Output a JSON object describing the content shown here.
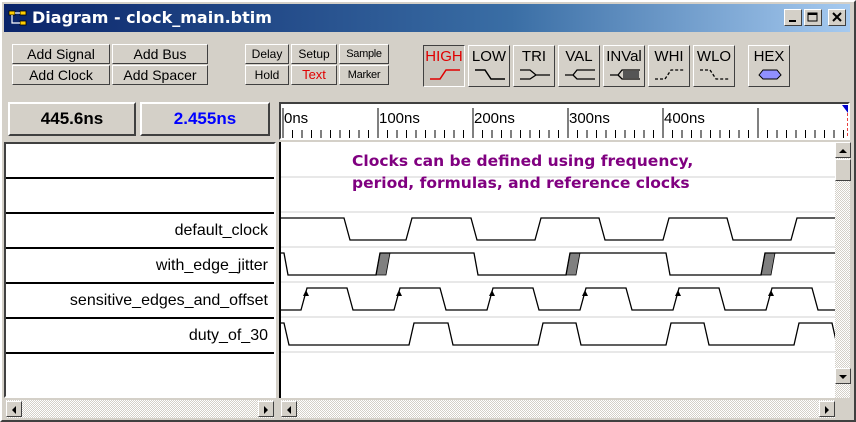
{
  "window": {
    "title": "Diagram - clock_main.btim",
    "controls": [
      "minimize-icon",
      "maximize-icon",
      "close-icon"
    ]
  },
  "toolbar": {
    "add_signal": "Add Signal",
    "add_bus": "Add Bus",
    "add_clock": "Add Clock",
    "add_spacer": "Add Spacer",
    "delay": "Delay",
    "setup": "Setup",
    "sample": "Sample",
    "hold": "Hold",
    "text": "Text",
    "marker": "Marker",
    "states": [
      {
        "label": "HIGH",
        "active": true
      },
      {
        "label": "LOW",
        "active": false
      },
      {
        "label": "TRI",
        "active": false
      },
      {
        "label": "VAL",
        "active": false
      },
      {
        "label": "INVal",
        "active": false
      },
      {
        "label": "WHI",
        "active": false
      },
      {
        "label": "WLO",
        "active": false
      },
      {
        "label": "HEX",
        "active": false
      }
    ],
    "text_color": "#e00000"
  },
  "cursor": {
    "time1": "445.6ns",
    "time2": "2.455ns",
    "time2_color": "#0000ff"
  },
  "ruler": {
    "labels": [
      "0ns",
      "100ns",
      "200ns",
      "300ns",
      "400ns"
    ]
  },
  "note": {
    "line1": "Clocks can be defined using frequency,",
    "line2": "period, formulas, and reference clocks",
    "color": "#800080"
  },
  "signals": [
    {
      "name": "",
      "type": "blank"
    },
    {
      "name": "",
      "type": "blank"
    },
    {
      "name": "default_clock",
      "type": "clock"
    },
    {
      "name": "with_edge_jitter",
      "type": "clock-jitter"
    },
    {
      "name": "sensitive_edges_and_offset",
      "type": "clock-sensitive"
    },
    {
      "name": "duty_of_30",
      "type": "clock-duty"
    }
  ]
}
